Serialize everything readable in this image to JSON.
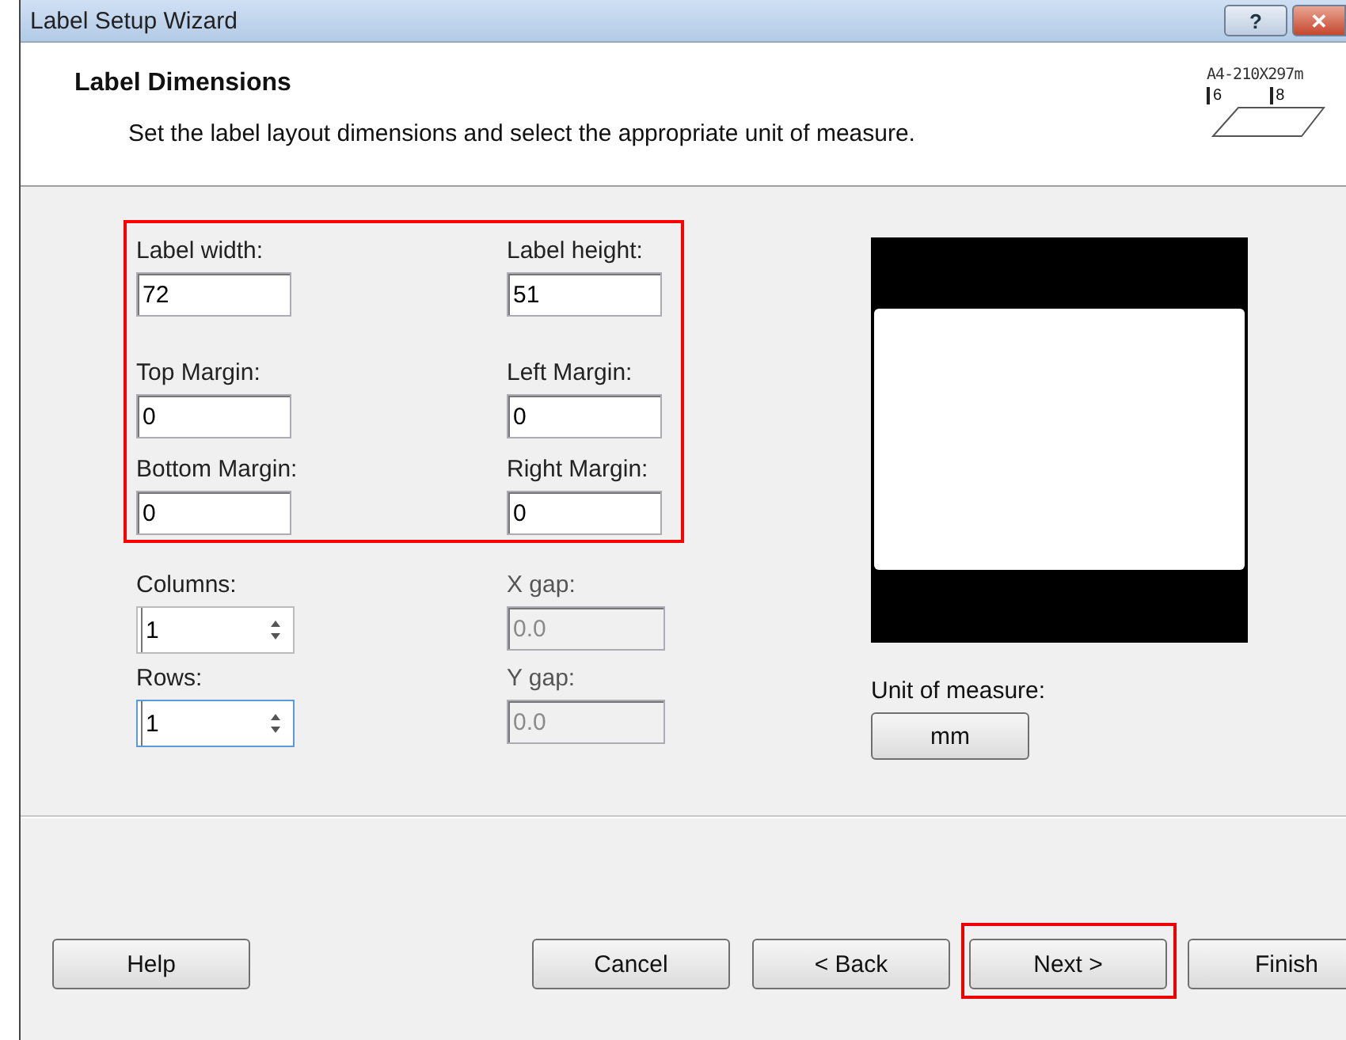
{
  "window": {
    "title": "Label Setup Wizard",
    "controls": [
      "?",
      "✕"
    ]
  },
  "header": {
    "title": "Label Dimensions",
    "subtitle": "Set the label layout dimensions and select the appropriate unit of measure.",
    "paper_size": "A4-210X297m",
    "ruler_marks": [
      "6",
      "8"
    ]
  },
  "dimensions": {
    "highlighted": true,
    "fields": [
      {
        "label": "Label width:",
        "value": "72"
      },
      {
        "label": "Label height:",
        "value": "51"
      },
      {
        "label": "Top Margin:",
        "value": "0"
      },
      {
        "label": "Left Margin:",
        "value": "0"
      },
      {
        "label": "Bottom Margin:",
        "value": "0"
      },
      {
        "label": "Right Margin:",
        "value": "0"
      }
    ]
  },
  "layout_fields": [
    {
      "label": "Columns:",
      "value": "1",
      "kind": "spinner",
      "disabled": false,
      "focused": false
    },
    {
      "label": "X gap:",
      "value": "0.0",
      "kind": "text",
      "disabled": true
    },
    {
      "label": "Rows:",
      "value": "1",
      "kind": "spinner",
      "disabled": false,
      "focused": true
    },
    {
      "label": "Y gap:",
      "value": "0.0",
      "kind": "text",
      "disabled": true
    }
  ],
  "unit": {
    "label": "Unit of measure:",
    "button": "mm"
  },
  "buttons": [
    {
      "label": "Help",
      "highlighted": false
    },
    {
      "label": "Cancel",
      "highlighted": false
    },
    {
      "label": "< Back",
      "highlighted": false
    },
    {
      "label": "Next >",
      "highlighted": true
    },
    {
      "label": "Finish",
      "highlighted": false
    }
  ]
}
